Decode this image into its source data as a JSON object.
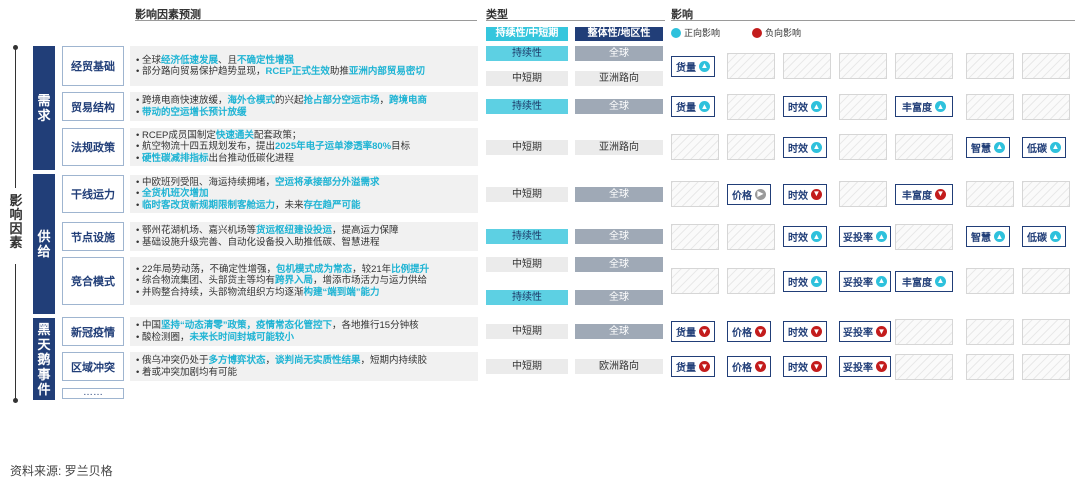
{
  "headers": {
    "factors_forecast": "影响因素预测",
    "type": "类型",
    "impact": "影响"
  },
  "type_tags": {
    "sustain_mid": "持续性/中短期",
    "overall_region": "整体性/地区性"
  },
  "legend": {
    "positive": "正向影响",
    "negative": "负向影响"
  },
  "axis_label": [
    "影",
    "响",
    "因",
    "素"
  ],
  "groups": {
    "demand": [
      "需",
      "求"
    ],
    "supply": [
      "供",
      "给"
    ],
    "black_swan": [
      "黑",
      "天",
      "鹅",
      "事",
      "件"
    ]
  },
  "factors": {
    "trade_base": "经贸基础",
    "trade_structure": "贸易结构",
    "law_policy": "法规政策",
    "trunk_capacity": "干线运力",
    "node_facility": "节点设施",
    "competition": "竞合模式",
    "covid": "新冠疫情",
    "regional_conflict": "区域冲突",
    "more": "……"
  },
  "descriptions": {
    "trade_base": [
      [
        {
          "t": "全球"
        },
        {
          "t": "经济低速发展",
          "h": true
        },
        {
          "t": "、且"
        },
        {
          "t": "不确定性增强",
          "h": true
        }
      ],
      [
        {
          "t": "部分路向贸易保护趋势显现，"
        },
        {
          "t": "RCEP正式生效",
          "h": true
        },
        {
          "t": "助推"
        },
        {
          "t": "亚洲内部贸易密切",
          "h": true
        }
      ]
    ],
    "trade_structure": [
      [
        {
          "t": "跨境电商快速放缓，"
        },
        {
          "t": "海外仓模式",
          "h": true
        },
        {
          "t": "的兴起"
        },
        {
          "t": "抢占部分空运市场",
          "h": true
        },
        {
          "t": "，"
        },
        {
          "t": "跨境电商",
          "h": true
        }
      ],
      [
        {
          "t": "带动的空运增长预计放缓",
          "h": true
        }
      ]
    ],
    "law_policy": [
      [
        {
          "t": "RCEP成员国制定"
        },
        {
          "t": "快速通关",
          "h": true
        },
        {
          "t": "配套政策；"
        }
      ],
      [
        {
          "t": "航空物流十四五规划发布，提出"
        },
        {
          "t": "2025年电子运单渗透率80%",
          "h": true
        },
        {
          "t": "目标"
        }
      ],
      [
        {
          "t": "硬性碳减排指标",
          "h": true
        },
        {
          "t": "出台推动低碳化进程"
        }
      ]
    ],
    "trunk_capacity": [
      [
        {
          "t": "中欧班列受阻、海运持续拥堵，"
        },
        {
          "t": "空运将承接部分外溢需求",
          "h": true
        }
      ],
      [
        {
          "t": "全货机班次增加",
          "h": true
        }
      ],
      [
        {
          "t": "临时客改货新规期限制客舱运力",
          "h": true
        },
        {
          "t": "，未来"
        },
        {
          "t": "存在趋严可能",
          "h": true
        }
      ]
    ],
    "node_facility": [
      [
        {
          "t": "鄂州花湖机场、嘉兴机场等"
        },
        {
          "t": "货运枢纽建设投运",
          "h": true
        },
        {
          "t": "，提高运力保障"
        }
      ],
      [
        {
          "t": "基础设施升级完善、自动化设备投入助推低碳、智慧进程"
        }
      ]
    ],
    "competition": [
      [
        {
          "t": "22年局势动荡，不确定性增强，"
        },
        {
          "t": "包机模式成为常态",
          "h": true
        },
        {
          "t": "，较21年"
        },
        {
          "t": "比例提升",
          "h": true
        }
      ],
      [
        {
          "t": "综合物流集团、头部货主等均有"
        },
        {
          "t": "跨界入局",
          "h": true
        },
        {
          "t": "，增添市场活力与运力供给"
        }
      ],
      [
        {
          "t": "并购整合持续，头部物流组织方均逐渐"
        },
        {
          "t": "构建“端到端”能力",
          "h": true
        }
      ]
    ],
    "covid": [
      [
        {
          "t": "中国"
        },
        {
          "t": "坚持“动态清零”政策，疫情常态化管控下",
          "h": true
        },
        {
          "t": "，各地推行15分钟核"
        }
      ],
      [
        {
          "t": "酸检测圈，"
        },
        {
          "t": "未来长时间封城可能较小",
          "h": true
        }
      ]
    ],
    "regional_conflict": [
      [
        {
          "t": "俄乌冲突仍处于"
        },
        {
          "t": "多方博弈状态",
          "h": true
        },
        {
          "t": "，"
        },
        {
          "t": "谈判尚无实质性结果",
          "h": true
        },
        {
          "t": "，短期内持续胶"
        }
      ],
      [
        {
          "t": "着或冲突加剧均有可能"
        }
      ]
    ]
  },
  "types": {
    "trade_base": {
      "sustain": [
        "持续性",
        "中短期"
      ],
      "scope": [
        "全球",
        "亚洲路向"
      ]
    },
    "trade_structure": {
      "sustain": [
        "持续性"
      ],
      "scope": [
        "全球"
      ]
    },
    "law_policy": {
      "sustain": [
        "中短期"
      ],
      "scope": [
        "亚洲路向"
      ]
    },
    "trunk_capacity": {
      "sustain": [
        "中短期"
      ],
      "scope": [
        "全球"
      ]
    },
    "node_facility": {
      "sustain": [
        "持续性"
      ],
      "scope": [
        "全球"
      ]
    },
    "competition": {
      "sustain": [
        "中短期",
        "持续性"
      ],
      "scope": [
        "全球",
        "全球"
      ]
    },
    "covid": {
      "sustain": [
        "中短期"
      ],
      "scope": [
        "全球"
      ]
    },
    "regional_conflict": {
      "sustain": [
        "中短期"
      ],
      "scope": [
        "欧洲路向"
      ]
    }
  },
  "impacts": {
    "volume": "货量",
    "price": "价格",
    "timeliness": "时效",
    "on_time_rate": "妥投率",
    "richness": "丰富度",
    "smart": "智慧",
    "low_carbon": "低碳"
  },
  "impact_matrix": {
    "trade_base": [
      {
        "col": 0,
        "label": "volume",
        "dir": "up"
      }
    ],
    "trade_structure": [
      {
        "col": 0,
        "label": "volume",
        "dir": "up"
      },
      {
        "col": 2,
        "label": "timeliness",
        "dir": "up"
      },
      {
        "col": 4,
        "label": "richness",
        "dir": "up"
      }
    ],
    "law_policy": [
      {
        "col": 2,
        "label": "timeliness",
        "dir": "up"
      },
      {
        "col": 5,
        "label": "smart",
        "dir": "up"
      },
      {
        "col": 6,
        "label": "low_carbon",
        "dir": "up"
      }
    ],
    "trunk_capacity": [
      {
        "col": 1,
        "label": "price",
        "dir": "right"
      },
      {
        "col": 2,
        "label": "timeliness",
        "dir": "down"
      },
      {
        "col": 4,
        "label": "richness",
        "dir": "down"
      }
    ],
    "node_facility": [
      {
        "col": 2,
        "label": "timeliness",
        "dir": "up"
      },
      {
        "col": 3,
        "label": "on_time_rate",
        "dir": "up"
      },
      {
        "col": 5,
        "label": "smart",
        "dir": "up"
      },
      {
        "col": 6,
        "label": "low_carbon",
        "dir": "up"
      }
    ],
    "competition": [
      {
        "col": 2,
        "label": "timeliness",
        "dir": "up"
      },
      {
        "col": 3,
        "label": "on_time_rate",
        "dir": "up"
      },
      {
        "col": 4,
        "label": "richness",
        "dir": "up"
      }
    ],
    "covid": [
      {
        "col": 0,
        "label": "volume",
        "dir": "down"
      },
      {
        "col": 1,
        "label": "price",
        "dir": "down"
      },
      {
        "col": 2,
        "label": "timeliness",
        "dir": "down"
      },
      {
        "col": 3,
        "label": "on_time_rate",
        "dir": "down"
      }
    ],
    "regional_conflict": [
      {
        "col": 0,
        "label": "volume",
        "dir": "down"
      },
      {
        "col": 1,
        "label": "price",
        "dir": "down"
      },
      {
        "col": 2,
        "label": "timeliness",
        "dir": "down"
      },
      {
        "col": 3,
        "label": "on_time_rate",
        "dir": "down"
      }
    ]
  },
  "colors": {
    "navy": "#213e78",
    "cyan": "#35c6dd",
    "positive": "#2ec1dc",
    "negative": "#c31c1c",
    "neutral": "#9a9a9a"
  },
  "source": "资料来源: 罗兰贝格"
}
